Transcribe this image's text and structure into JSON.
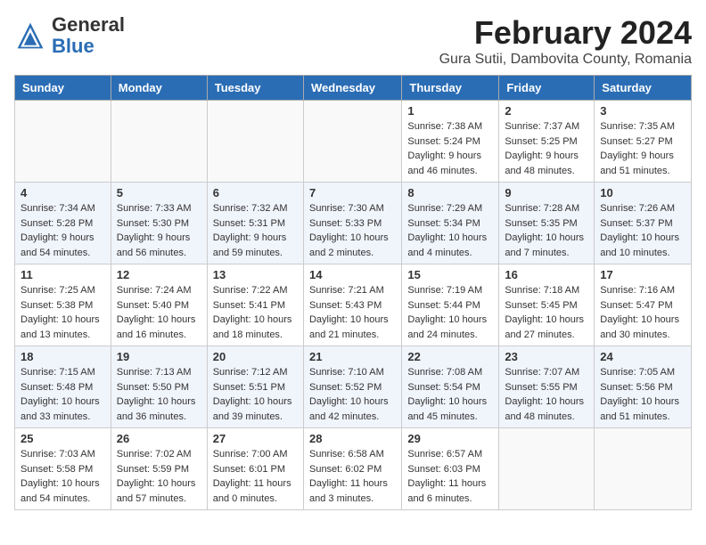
{
  "header": {
    "logo_general": "General",
    "logo_blue": "Blue",
    "month": "February 2024",
    "location": "Gura Sutii, Dambovita County, Romania"
  },
  "weekdays": [
    "Sunday",
    "Monday",
    "Tuesday",
    "Wednesday",
    "Thursday",
    "Friday",
    "Saturday"
  ],
  "weeks": [
    [
      {
        "day": "",
        "info": ""
      },
      {
        "day": "",
        "info": ""
      },
      {
        "day": "",
        "info": ""
      },
      {
        "day": "",
        "info": ""
      },
      {
        "day": "1",
        "info": "Sunrise: 7:38 AM\nSunset: 5:24 PM\nDaylight: 9 hours\nand 46 minutes."
      },
      {
        "day": "2",
        "info": "Sunrise: 7:37 AM\nSunset: 5:25 PM\nDaylight: 9 hours\nand 48 minutes."
      },
      {
        "day": "3",
        "info": "Sunrise: 7:35 AM\nSunset: 5:27 PM\nDaylight: 9 hours\nand 51 minutes."
      }
    ],
    [
      {
        "day": "4",
        "info": "Sunrise: 7:34 AM\nSunset: 5:28 PM\nDaylight: 9 hours\nand 54 minutes."
      },
      {
        "day": "5",
        "info": "Sunrise: 7:33 AM\nSunset: 5:30 PM\nDaylight: 9 hours\nand 56 minutes."
      },
      {
        "day": "6",
        "info": "Sunrise: 7:32 AM\nSunset: 5:31 PM\nDaylight: 9 hours\nand 59 minutes."
      },
      {
        "day": "7",
        "info": "Sunrise: 7:30 AM\nSunset: 5:33 PM\nDaylight: 10 hours\nand 2 minutes."
      },
      {
        "day": "8",
        "info": "Sunrise: 7:29 AM\nSunset: 5:34 PM\nDaylight: 10 hours\nand 4 minutes."
      },
      {
        "day": "9",
        "info": "Sunrise: 7:28 AM\nSunset: 5:35 PM\nDaylight: 10 hours\nand 7 minutes."
      },
      {
        "day": "10",
        "info": "Sunrise: 7:26 AM\nSunset: 5:37 PM\nDaylight: 10 hours\nand 10 minutes."
      }
    ],
    [
      {
        "day": "11",
        "info": "Sunrise: 7:25 AM\nSunset: 5:38 PM\nDaylight: 10 hours\nand 13 minutes."
      },
      {
        "day": "12",
        "info": "Sunrise: 7:24 AM\nSunset: 5:40 PM\nDaylight: 10 hours\nand 16 minutes."
      },
      {
        "day": "13",
        "info": "Sunrise: 7:22 AM\nSunset: 5:41 PM\nDaylight: 10 hours\nand 18 minutes."
      },
      {
        "day": "14",
        "info": "Sunrise: 7:21 AM\nSunset: 5:43 PM\nDaylight: 10 hours\nand 21 minutes."
      },
      {
        "day": "15",
        "info": "Sunrise: 7:19 AM\nSunset: 5:44 PM\nDaylight: 10 hours\nand 24 minutes."
      },
      {
        "day": "16",
        "info": "Sunrise: 7:18 AM\nSunset: 5:45 PM\nDaylight: 10 hours\nand 27 minutes."
      },
      {
        "day": "17",
        "info": "Sunrise: 7:16 AM\nSunset: 5:47 PM\nDaylight: 10 hours\nand 30 minutes."
      }
    ],
    [
      {
        "day": "18",
        "info": "Sunrise: 7:15 AM\nSunset: 5:48 PM\nDaylight: 10 hours\nand 33 minutes."
      },
      {
        "day": "19",
        "info": "Sunrise: 7:13 AM\nSunset: 5:50 PM\nDaylight: 10 hours\nand 36 minutes."
      },
      {
        "day": "20",
        "info": "Sunrise: 7:12 AM\nSunset: 5:51 PM\nDaylight: 10 hours\nand 39 minutes."
      },
      {
        "day": "21",
        "info": "Sunrise: 7:10 AM\nSunset: 5:52 PM\nDaylight: 10 hours\nand 42 minutes."
      },
      {
        "day": "22",
        "info": "Sunrise: 7:08 AM\nSunset: 5:54 PM\nDaylight: 10 hours\nand 45 minutes."
      },
      {
        "day": "23",
        "info": "Sunrise: 7:07 AM\nSunset: 5:55 PM\nDaylight: 10 hours\nand 48 minutes."
      },
      {
        "day": "24",
        "info": "Sunrise: 7:05 AM\nSunset: 5:56 PM\nDaylight: 10 hours\nand 51 minutes."
      }
    ],
    [
      {
        "day": "25",
        "info": "Sunrise: 7:03 AM\nSunset: 5:58 PM\nDaylight: 10 hours\nand 54 minutes."
      },
      {
        "day": "26",
        "info": "Sunrise: 7:02 AM\nSunset: 5:59 PM\nDaylight: 10 hours\nand 57 minutes."
      },
      {
        "day": "27",
        "info": "Sunrise: 7:00 AM\nSunset: 6:01 PM\nDaylight: 11 hours\nand 0 minutes."
      },
      {
        "day": "28",
        "info": "Sunrise: 6:58 AM\nSunset: 6:02 PM\nDaylight: 11 hours\nand 3 minutes."
      },
      {
        "day": "29",
        "info": "Sunrise: 6:57 AM\nSunset: 6:03 PM\nDaylight: 11 hours\nand 6 minutes."
      },
      {
        "day": "",
        "info": ""
      },
      {
        "day": "",
        "info": ""
      }
    ]
  ]
}
